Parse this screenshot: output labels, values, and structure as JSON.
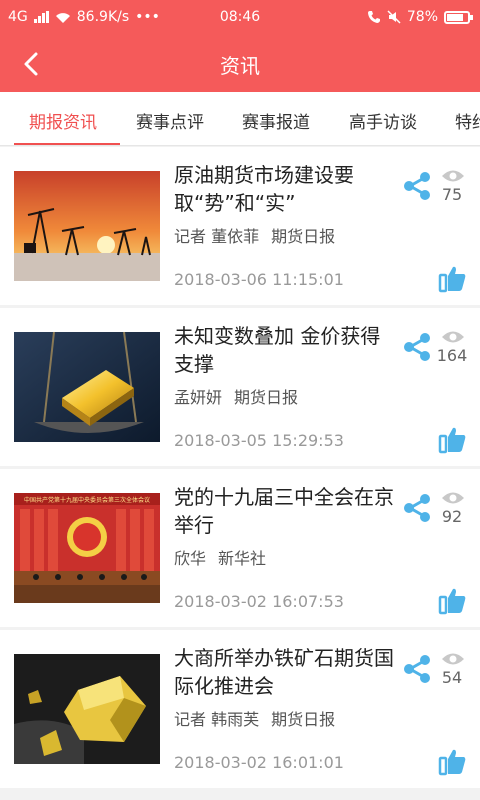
{
  "status_bar": {
    "network": "4G",
    "speed": "86.9K/s",
    "dots": "•••",
    "time": "08:46",
    "battery": "78%",
    "battery_level": 0.78
  },
  "header": {
    "title": "资讯"
  },
  "tabs": [
    {
      "label": "期报资讯",
      "active": true
    },
    {
      "label": "赛事点评"
    },
    {
      "label": "赛事报道"
    },
    {
      "label": "高手访谈"
    },
    {
      "label": "特约"
    }
  ],
  "articles": [
    {
      "title": "原油期货市场建设要取“势”和“实”",
      "author": "记者 董依菲",
      "source": "期货日报",
      "date": "2018-03-06 11:15:01",
      "views": "75",
      "image": "oil-derricks-sunset"
    },
    {
      "title": "未知变数叠加 金价获得支撑",
      "author": "孟妍妍",
      "source": "期货日报",
      "date": "2018-03-05 15:29:53",
      "views": "164",
      "image": "gold-bar-scale"
    },
    {
      "title": "党的十九届三中全会在京举行",
      "author": "欣华",
      "source": "新华社",
      "date": "2018-03-02 16:07:53",
      "views": "92",
      "image": "plenary-session-hall",
      "image_banner": "中国共产党第十九届中央委员会第三次全体会议"
    },
    {
      "title": "大商所举办铁矿石期货国际化推进会",
      "author": "记者 韩雨芙",
      "source": "期货日报",
      "date": "2018-03-02 16:01:01",
      "views": "54",
      "image": "pyrite-crystal"
    }
  ],
  "colors": {
    "brand": "#f55a5a",
    "tab_active": "#f05050",
    "icon_blue": "#4fb3e8",
    "icon_gray": "#c8c8c8"
  }
}
